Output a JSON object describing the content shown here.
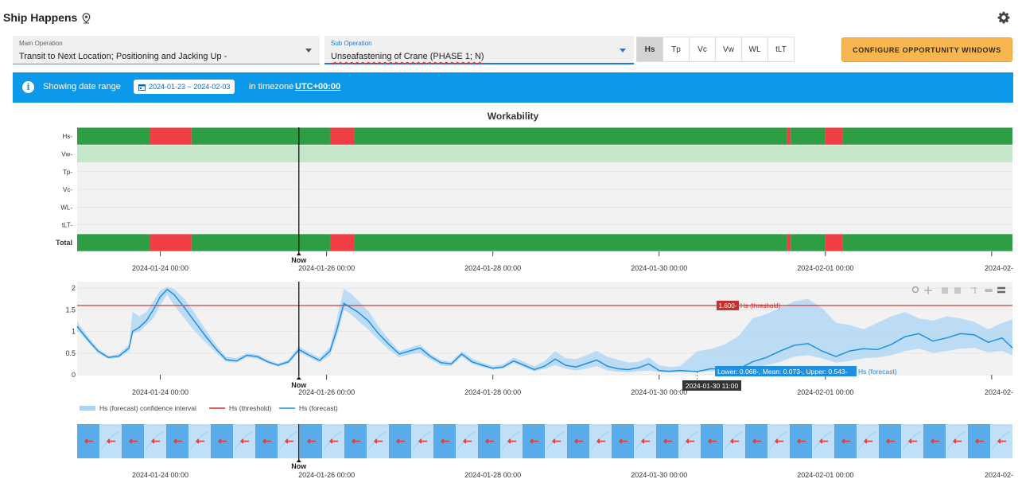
{
  "app": {
    "title": "Ship Happens"
  },
  "main_operation": {
    "label": "Main Operation",
    "value": "Transit to Next Location; Positioning and Jacking Up -"
  },
  "sub_operation": {
    "label": "Sub Operation",
    "value": "Unseafastening of Crane (PHASE 1; N)"
  },
  "param_toggles": [
    {
      "label": "Hs",
      "selected": true
    },
    {
      "label": "Tp",
      "selected": false
    },
    {
      "label": "Vc",
      "selected": false
    },
    {
      "label": "Vw",
      "selected": false
    },
    {
      "label": "WL",
      "selected": false
    },
    {
      "label": "tLT",
      "selected": false
    }
  ],
  "configure_button": "CONFIGURE OPPORTUNITY WINDOWS",
  "banner": {
    "prefix": "Showing date range",
    "date_range": "2024-01-23 ~ 2024-02-03",
    "middle": "in timezone",
    "timezone": "UTC+00:00"
  },
  "colors": {
    "go": "#2e9e44",
    "nogo": "#ef3f45",
    "light_go": "#c3e7c8",
    "primary": "#0d99ea",
    "threshold": "#d62728",
    "forecast": "#1f8fe0"
  },
  "x_ticks": [
    "2024-01-24 00:00",
    "2024-01-26 00:00",
    "2024-01-28 00:00",
    "2024-01-30 00:00",
    "2024-02-01 00:00",
    "2024-02-"
  ],
  "now_label": "Now",
  "chart_data": [
    {
      "type": "heatmap",
      "title": "Workability",
      "rows": [
        "Hs",
        "Vw",
        "Tp",
        "Vc",
        "WL",
        "tLT",
        "Total"
      ],
      "x_start": "2024-01-23 00:00",
      "x_end": "2024-02-03 06:00",
      "now": "2024-01-25 16:00",
      "status_segments": {
        "Hs": [
          {
            "start": "2024-01-23 00:00",
            "end": "2024-01-23 21:00",
            "status": "go"
          },
          {
            "start": "2024-01-23 21:00",
            "end": "2024-01-24 09:00",
            "status": "nogo"
          },
          {
            "start": "2024-01-24 09:00",
            "end": "2024-01-26 01:00",
            "status": "go"
          },
          {
            "start": "2024-01-26 01:00",
            "end": "2024-01-26 08:00",
            "status": "nogo"
          },
          {
            "start": "2024-01-26 08:00",
            "end": "2024-01-31 13:00",
            "status": "go"
          },
          {
            "start": "2024-01-31 13:00",
            "end": "2024-01-31 14:00",
            "status": "nogo"
          },
          {
            "start": "2024-01-31 14:00",
            "end": "2024-02-01 00:00",
            "status": "go"
          },
          {
            "start": "2024-02-01 00:00",
            "end": "2024-02-01 05:00",
            "status": "nogo"
          },
          {
            "start": "2024-02-01 05:00",
            "end": "2024-02-03 06:00",
            "status": "go"
          }
        ],
        "Vw": [
          {
            "start": "2024-01-23 00:00",
            "end": "2024-02-03 06:00",
            "status": "light_go"
          }
        ],
        "Total": [
          {
            "start": "2024-01-23 00:00",
            "end": "2024-01-23 21:00",
            "status": "go"
          },
          {
            "start": "2024-01-23 21:00",
            "end": "2024-01-24 09:00",
            "status": "nogo"
          },
          {
            "start": "2024-01-24 09:00",
            "end": "2024-01-26 01:00",
            "status": "go"
          },
          {
            "start": "2024-01-26 01:00",
            "end": "2024-01-26 08:00",
            "status": "nogo"
          },
          {
            "start": "2024-01-26 08:00",
            "end": "2024-01-31 13:00",
            "status": "go"
          },
          {
            "start": "2024-01-31 13:00",
            "end": "2024-01-31 14:00",
            "status": "nogo"
          },
          {
            "start": "2024-01-31 14:00",
            "end": "2024-02-01 00:00",
            "status": "go"
          },
          {
            "start": "2024-02-01 00:00",
            "end": "2024-02-01 05:00",
            "status": "nogo"
          },
          {
            "start": "2024-02-01 05:00",
            "end": "2024-02-03 06:00",
            "status": "go"
          }
        ]
      }
    },
    {
      "type": "line",
      "y_ticks": [
        0,
        0.5,
        1,
        1.5,
        2
      ],
      "ylim": [
        0,
        2.15
      ],
      "threshold": {
        "value": 1.6,
        "label": "1.600-",
        "name": "Hs (threshold)"
      },
      "series": [
        {
          "name": "Hs (forecast)",
          "kind": "line"
        },
        {
          "name": "Hs (forecast) confidence interval",
          "kind": "band"
        }
      ],
      "points": [
        [
          "2024-01-23 00:00",
          1.12,
          1.04,
          1.22
        ],
        [
          "2024-01-23 03:00",
          0.82,
          0.76,
          0.9
        ],
        [
          "2024-01-23 06:00",
          0.55,
          0.5,
          0.6
        ],
        [
          "2024-01-23 09:00",
          0.4,
          0.37,
          0.44
        ],
        [
          "2024-01-23 12:00",
          0.43,
          0.39,
          0.48
        ],
        [
          "2024-01-23 15:00",
          0.62,
          0.55,
          0.7
        ],
        [
          "2024-01-23 16:00",
          1.0,
          0.95,
          1.45
        ],
        [
          "2024-01-23 18:00",
          1.1,
          1.0,
          1.35
        ],
        [
          "2024-01-23 20:00",
          1.25,
          1.15,
          1.45
        ],
        [
          "2024-01-23 22:00",
          1.5,
          1.3,
          1.7
        ],
        [
          "2024-01-24 00:00",
          1.8,
          1.6,
          1.95
        ],
        [
          "2024-01-24 02:00",
          1.97,
          1.85,
          2.03
        ],
        [
          "2024-01-24 04:00",
          1.85,
          1.6,
          1.98
        ],
        [
          "2024-01-24 07:00",
          1.55,
          1.3,
          1.75
        ],
        [
          "2024-01-24 10:00",
          1.22,
          1.0,
          1.42
        ],
        [
          "2024-01-24 13:00",
          0.9,
          0.75,
          1.05
        ],
        [
          "2024-01-24 16:00",
          0.6,
          0.52,
          0.7
        ],
        [
          "2024-01-24 19:00",
          0.35,
          0.3,
          0.42
        ],
        [
          "2024-01-24 22:00",
          0.32,
          0.28,
          0.38
        ],
        [
          "2024-01-25 01:00",
          0.45,
          0.4,
          0.5
        ],
        [
          "2024-01-25 04:00",
          0.42,
          0.37,
          0.47
        ],
        [
          "2024-01-25 07:00",
          0.3,
          0.26,
          0.35
        ],
        [
          "2024-01-25 10:00",
          0.22,
          0.19,
          0.26
        ],
        [
          "2024-01-25 13:00",
          0.3,
          0.26,
          0.35
        ],
        [
          "2024-01-25 16:00",
          0.58,
          0.52,
          0.66
        ],
        [
          "2024-01-25 19:00",
          0.45,
          0.4,
          0.52
        ],
        [
          "2024-01-25 22:00",
          0.33,
          0.28,
          0.4
        ],
        [
          "2024-01-26 01:00",
          0.55,
          0.45,
          0.65
        ],
        [
          "2024-01-26 03:00",
          1.05,
          0.9,
          1.3
        ],
        [
          "2024-01-26 05:00",
          1.65,
          1.5,
          1.98
        ],
        [
          "2024-01-26 07:00",
          1.55,
          1.4,
          1.88
        ],
        [
          "2024-01-26 09:00",
          1.45,
          1.25,
          1.72
        ],
        [
          "2024-01-26 12:00",
          1.25,
          1.05,
          1.48
        ],
        [
          "2024-01-26 15:00",
          0.95,
          0.8,
          1.12
        ],
        [
          "2024-01-26 18:00",
          0.7,
          0.58,
          0.82
        ],
        [
          "2024-01-26 21:00",
          0.48,
          0.4,
          0.55
        ],
        [
          "2024-01-27 00:00",
          0.55,
          0.47,
          0.62
        ],
        [
          "2024-01-27 03:00",
          0.62,
          0.5,
          0.7
        ],
        [
          "2024-01-27 06:00",
          0.42,
          0.35,
          0.48
        ],
        [
          "2024-01-27 09:00",
          0.28,
          0.22,
          0.34
        ],
        [
          "2024-01-27 12:00",
          0.25,
          0.2,
          0.3
        ],
        [
          "2024-01-27 15:00",
          0.48,
          0.42,
          0.55
        ],
        [
          "2024-01-27 18:00",
          0.3,
          0.25,
          0.38
        ],
        [
          "2024-01-27 21:00",
          0.22,
          0.18,
          0.28
        ],
        [
          "2024-01-28 00:00",
          0.15,
          0.12,
          0.2
        ],
        [
          "2024-01-28 03:00",
          0.18,
          0.14,
          0.24
        ],
        [
          "2024-01-28 06:00",
          0.32,
          0.27,
          0.4
        ],
        [
          "2024-01-28 09:00",
          0.22,
          0.17,
          0.3
        ],
        [
          "2024-01-28 12:00",
          0.12,
          0.08,
          0.2
        ],
        [
          "2024-01-28 15:00",
          0.2,
          0.14,
          0.32
        ],
        [
          "2024-01-28 18:00",
          0.36,
          0.22,
          0.55
        ],
        [
          "2024-01-28 21:00",
          0.22,
          0.14,
          0.38
        ],
        [
          "2024-01-29 00:00",
          0.18,
          0.1,
          0.36
        ],
        [
          "2024-01-29 03:00",
          0.26,
          0.14,
          0.45
        ],
        [
          "2024-01-29 06:00",
          0.34,
          0.2,
          0.55
        ],
        [
          "2024-01-29 09:00",
          0.2,
          0.1,
          0.42
        ],
        [
          "2024-01-29 12:00",
          0.14,
          0.07,
          0.35
        ],
        [
          "2024-01-29 15:00",
          0.12,
          0.06,
          0.28
        ],
        [
          "2024-01-29 18:00",
          0.16,
          0.08,
          0.3
        ],
        [
          "2024-01-29 21:00",
          0.25,
          0.1,
          0.4
        ],
        [
          "2024-01-30 00:00",
          0.1,
          0.06,
          0.22
        ],
        [
          "2024-01-30 03:00",
          0.08,
          0.05,
          0.18
        ],
        [
          "2024-01-30 06:00",
          0.1,
          0.06,
          0.2
        ],
        [
          "2024-01-30 11:00",
          0.073,
          0.068,
          0.543
        ],
        [
          "2024-01-30 15:00",
          0.14,
          0.08,
          0.6
        ],
        [
          "2024-01-30 19:00",
          0.12,
          0.08,
          0.7
        ],
        [
          "2024-01-30 23:00",
          0.14,
          0.08,
          0.9
        ],
        [
          "2024-01-31 03:00",
          0.3,
          0.15,
          1.3
        ],
        [
          "2024-01-31 07:00",
          0.4,
          0.22,
          1.4
        ],
        [
          "2024-01-31 11:00",
          0.55,
          0.3,
          1.55
        ],
        [
          "2024-01-31 15:00",
          0.68,
          0.42,
          1.7
        ],
        [
          "2024-01-31 19:00",
          0.72,
          0.45,
          1.75
        ],
        [
          "2024-01-31 23:00",
          0.55,
          0.38,
          1.55
        ],
        [
          "2024-02-01 03:00",
          0.42,
          0.28,
          1.2
        ],
        [
          "2024-02-01 07:00",
          0.55,
          0.32,
          1.15
        ],
        [
          "2024-02-01 11:00",
          0.6,
          0.38,
          1.05
        ],
        [
          "2024-02-01 15:00",
          0.58,
          0.4,
          1.2
        ],
        [
          "2024-02-01 19:00",
          0.7,
          0.45,
          1.35
        ],
        [
          "2024-02-01 23:00",
          0.88,
          0.55,
          1.45
        ],
        [
          "2024-02-02 03:00",
          0.95,
          0.6,
          1.3
        ],
        [
          "2024-02-02 07:00",
          0.78,
          0.5,
          1.25
        ],
        [
          "2024-02-02 11:00",
          0.85,
          0.55,
          1.35
        ],
        [
          "2024-02-02 15:00",
          0.95,
          0.6,
          1.3
        ],
        [
          "2024-02-02 19:00",
          0.92,
          0.62,
          1.22
        ],
        [
          "2024-02-02 23:00",
          0.75,
          0.52,
          1.05
        ],
        [
          "2024-02-03 03:00",
          0.85,
          0.55,
          1.2
        ],
        [
          "2024-02-03 06:00",
          0.62,
          0.45,
          1.28
        ]
      ],
      "hover": {
        "time": "2024-01-30 11:00",
        "lower": 0.068,
        "mean": 0.073,
        "upper": 0.543,
        "time_label": "2024-01-30 11:00",
        "text": "Lower: 0.068-, Mean: 0.073-, Upper: 0.543-",
        "series": "Hs (forecast)"
      },
      "legend": [
        "Hs (forecast) confidence interval",
        "Hs (threshold)",
        "Hs (forecast)"
      ]
    },
    {
      "type": "heatmap",
      "subtype": "direction-strip",
      "note_values": "alternating shaded cells with arrows pointing left",
      "cells": 42
    }
  ],
  "modebar_icons": [
    "zoom-icon",
    "pan-icon",
    "zoom-in-icon",
    "zoom-out-icon",
    "autoscale-icon",
    "reset-axes-icon",
    "hover-compare-icon"
  ]
}
